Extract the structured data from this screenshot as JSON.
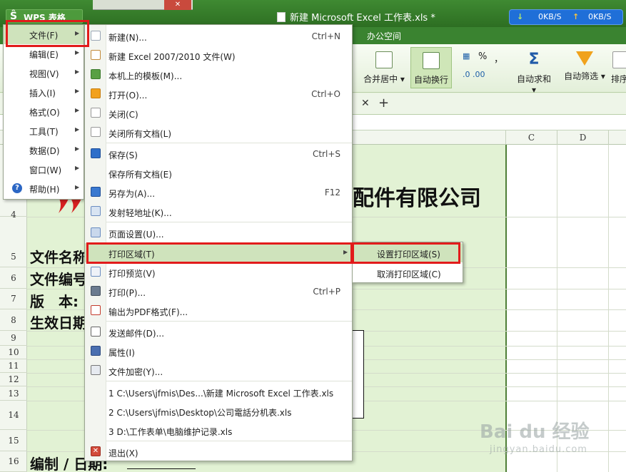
{
  "titlebar": {
    "app_name": "WPS 表格",
    "doc_title": "新建 Microsoft Excel 工作表.xls *",
    "download_speed": "0KB/S",
    "upload_speed": "0KB/S",
    "close_glyph": "✕"
  },
  "ribbon": {
    "tab_office": "办公空间",
    "merge_label": "合并居中 ▾",
    "wrap_label": "自动换行",
    "percent": "%",
    "comma": "，",
    "dec_inc": ".0 .00",
    "dec_dec": ".00 .0",
    "autosum_label": "自动求和 ▾",
    "filter_label": "自动筛选 ▾",
    "sort_label": "排序"
  },
  "sheet_bar": {
    "close": "✕",
    "add": "+"
  },
  "grid": {
    "columns": [
      "C",
      "D"
    ],
    "rows": [
      {
        "label": "4"
      },
      {
        "label": "5"
      },
      {
        "label": "6"
      },
      {
        "label": "7"
      },
      {
        "label": "8"
      },
      {
        "label": "9"
      },
      {
        "label": "10"
      },
      {
        "label": "11"
      },
      {
        "label": "12"
      },
      {
        "label": "13"
      },
      {
        "label": "14"
      },
      {
        "label": "15"
      },
      {
        "label": "16"
      }
    ],
    "company_name": "配件有限公司",
    "label_filename": "文件名称",
    "label_fileno": "文件编号",
    "label_version": "版　本:",
    "label_effective": "生效日期",
    "label_editor": "编制 / 日期:"
  },
  "main_menu": {
    "items": [
      {
        "label": "文件(F)"
      },
      {
        "label": "编辑(E)"
      },
      {
        "label": "视图(V)"
      },
      {
        "label": "插入(I)"
      },
      {
        "label": "格式(O)"
      },
      {
        "label": "工具(T)"
      },
      {
        "label": "数据(D)"
      },
      {
        "label": "窗口(W)"
      },
      {
        "label": "帮助(H)"
      }
    ],
    "help_glyph": "?"
  },
  "file_menu": {
    "new": {
      "label": "新建(N)...",
      "shortcut": "Ctrl+N"
    },
    "new_excel": {
      "label": "新建 Excel 2007/2010 文件(W)"
    },
    "template": {
      "label": "本机上的模板(M)..."
    },
    "open": {
      "label": "打开(O)...",
      "shortcut": "Ctrl+O"
    },
    "close": {
      "label": "关闭(C)"
    },
    "close_all": {
      "label": "关闭所有文档(L)"
    },
    "save": {
      "label": "保存(S)",
      "shortcut": "Ctrl+S"
    },
    "save_all": {
      "label": "保存所有文档(E)"
    },
    "save_as": {
      "label": "另存为(A)...",
      "shortcut": "F12"
    },
    "send_light": {
      "label": "发射轻地址(K)..."
    },
    "page_setup": {
      "label": "页面设置(U)..."
    },
    "print_area": {
      "label": "打印区域(T)"
    },
    "print_preview": {
      "label": "打印预览(V)"
    },
    "print": {
      "label": "打印(P)...",
      "shortcut": "Ctrl+P"
    },
    "export_pdf": {
      "label": "输出为PDF格式(F)..."
    },
    "send_mail": {
      "label": "发送邮件(D)..."
    },
    "properties": {
      "label": "属性(I)"
    },
    "encrypt": {
      "label": "文件加密(Y)..."
    },
    "recent1": {
      "label": "1 C:\\Users\\jfmis\\Des...\\新建 Microsoft Excel 工作表.xls"
    },
    "recent2": {
      "label": "2 C:\\Users\\jfmis\\Desktop\\公司電話分机表.xls"
    },
    "recent3": {
      "label": "3 D:\\工作表单\\电脑维护记录.xls"
    },
    "exit": {
      "label": "退出(X)"
    },
    "exit_glyph": "✕"
  },
  "print_area_menu": {
    "set": "设置打印区域(S)",
    "cancel": "取消打印区域(C)"
  },
  "watermark": {
    "brand": "Bai du 经验",
    "url": "jingyan.baidu.com"
  }
}
